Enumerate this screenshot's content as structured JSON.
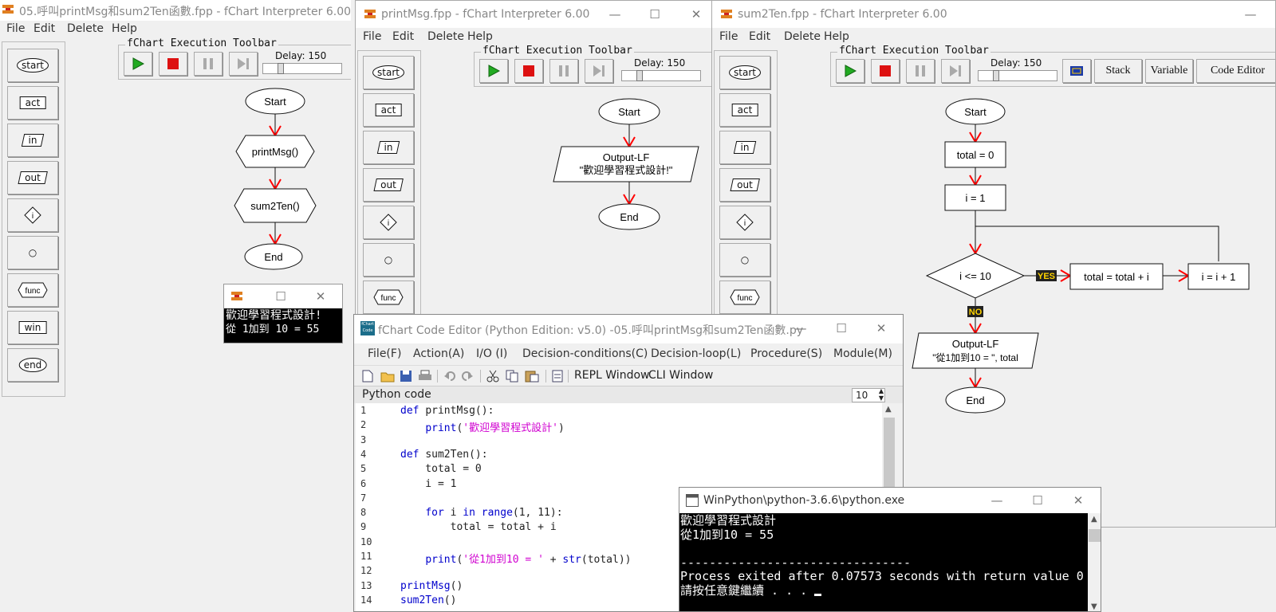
{
  "window1": {
    "title": "05.呼叫printMsg和sum2Ten函數.fpp - fChart Interpreter 6.00",
    "menu": [
      "File",
      "Edit",
      "Delete",
      "Help"
    ],
    "toolbar_title": "fChart Execution Toolbar",
    "delay_label": "Delay: 150",
    "flow": {
      "start": "Start",
      "call1": "printMsg()",
      "call2": "sum2Ten()",
      "end": "End"
    }
  },
  "window2": {
    "title": "printMsg.fpp - fChart Interpreter 6.00",
    "menu": [
      "File",
      "Edit",
      "Delete",
      "Help"
    ],
    "toolbar_title": "fChart Execution Toolbar",
    "delay_label": "Delay: 150",
    "flow": {
      "start": "Start",
      "out_line1": "Output-LF",
      "out_line2": "\"歡迎學習程式設計!\"",
      "end": "End"
    }
  },
  "window3": {
    "title": "sum2Ten.fpp - fChart Interpreter 6.00",
    "menu": [
      "File",
      "Edit",
      "Delete",
      "Help"
    ],
    "toolbar_title": "fChart Execution Toolbar",
    "delay_label": "Delay: 150",
    "buttons": {
      "stack": "Stack",
      "variable": "Variable",
      "code_editor": "Code Editor"
    },
    "flow": {
      "start": "Start",
      "total_init": "total = 0",
      "i_init": "i = 1",
      "decision": "i <= 10",
      "yes": "YES",
      "no": "NO",
      "accumulate": "total = total + i",
      "increment": "i = i + 1",
      "out_line1": "Output-LF",
      "out_line2": "\"從1加到10 = \", total",
      "end": "End"
    }
  },
  "palette": [
    "start",
    "act",
    "in",
    "out",
    "i",
    "○",
    "func",
    "win",
    "end"
  ],
  "small_console": {
    "line1": "歡迎學習程式設計!",
    "line2": "從 1加到 10 =  55"
  },
  "editor": {
    "title": "fChart Code Editor (Python Edition:  v5.0) -05.呼叫printMsg和sum2Ten函數.py",
    "icon_label": "fChart Code",
    "menu": [
      "File(F)",
      "Action(A)",
      "I/O (I)",
      "Decision-conditions(C)",
      "Decision-loop(L)",
      "Procedure(S)",
      "Module(M)"
    ],
    "toolbar_text": [
      "REPL Window",
      "CLI Window"
    ],
    "panel_label": "Python code",
    "font_size": "10",
    "lines": [
      {
        "n": "1",
        "parts": [
          [
            "kw",
            "def "
          ],
          [
            "fn",
            "printMsg():"
          ]
        ]
      },
      {
        "n": "2",
        "parts": [
          [
            "fn",
            "    "
          ],
          [
            "kw",
            "print"
          ],
          [
            "fn",
            "("
          ],
          [
            "str",
            "'歡迎學習程式設計'"
          ],
          [
            "fn",
            ")"
          ]
        ]
      },
      {
        "n": "3",
        "parts": []
      },
      {
        "n": "4",
        "parts": [
          [
            "kw",
            "def "
          ],
          [
            "fn",
            "sum2Ten():"
          ]
        ]
      },
      {
        "n": "5",
        "parts": [
          [
            "fn",
            "    total = 0"
          ]
        ]
      },
      {
        "n": "6",
        "parts": [
          [
            "fn",
            "    i = 1"
          ]
        ]
      },
      {
        "n": "7",
        "parts": []
      },
      {
        "n": "8",
        "parts": [
          [
            "fn",
            "    "
          ],
          [
            "kw",
            "for"
          ],
          [
            "fn",
            " i "
          ],
          [
            "kw",
            "in"
          ],
          [
            "fn",
            " "
          ],
          [
            "kw",
            "range"
          ],
          [
            "fn",
            "(1, 11):"
          ]
        ]
      },
      {
        "n": "9",
        "parts": [
          [
            "fn",
            "        total = total + i"
          ]
        ]
      },
      {
        "n": "10",
        "parts": []
      },
      {
        "n": "11",
        "parts": [
          [
            "fn",
            "    "
          ],
          [
            "kw",
            "print"
          ],
          [
            "fn",
            "("
          ],
          [
            "str",
            "'從1加到10 = '"
          ],
          [
            "fn",
            " + "
          ],
          [
            "kw",
            "str"
          ],
          [
            "fn",
            "(total))"
          ]
        ]
      },
      {
        "n": "12",
        "parts": []
      },
      {
        "n": "13",
        "parts": [
          [
            "kw",
            "printMsg"
          ],
          [
            "fn",
            "()"
          ]
        ]
      },
      {
        "n": "14",
        "parts": [
          [
            "kw",
            "sum2Ten"
          ],
          [
            "fn",
            "()"
          ]
        ]
      }
    ]
  },
  "python_console": {
    "title": "WinPython\\python-3.6.6\\python.exe",
    "lines": [
      "歡迎學習程式設計",
      "從1加到10 = 55",
      "",
      "--------------------------------",
      "Process exited after 0.07573 seconds with return value 0",
      "請按任意鍵繼續 . . . "
    ]
  },
  "colors": {
    "play": "#22aa22",
    "stop": "#dd1111",
    "arrow": "#ff0000",
    "keyword": "#0000cc",
    "string": "#d000d0"
  }
}
